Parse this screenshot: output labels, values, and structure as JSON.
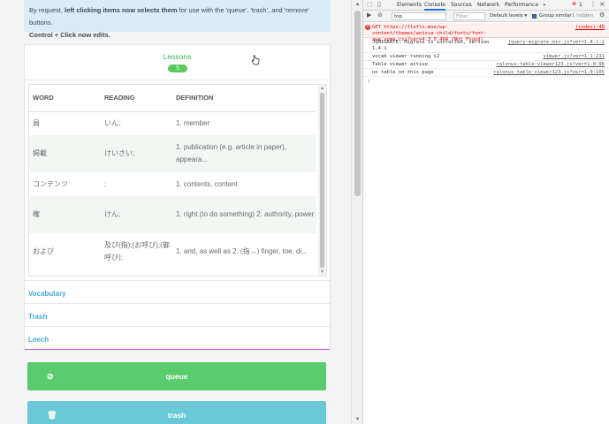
{
  "notice": {
    "line1_pre": "By request, ",
    "line1_bold": "left clicking items now selects them",
    "line1_post": " for use with the 'queue', 'trash', and 'remove' buttons.",
    "line2": "Control + Click now edits."
  },
  "lessons": {
    "title": "Lessons",
    "count": "5"
  },
  "table": {
    "headers": [
      "WORD",
      "READING",
      "DEFINITION"
    ],
    "rows": [
      {
        "word": "員",
        "reading": "いん;",
        "definition": "1. member"
      },
      {
        "word": "掲載",
        "reading": "けいさい;",
        "definition": "1. publication (e.g. article in paper), appeara..."
      },
      {
        "word": "コンテンツ",
        "reading": ";",
        "definition": "1. contents, content"
      },
      {
        "word": "権",
        "reading": "けん;",
        "definition": "1. right (to do something) 2. authority, power"
      },
      {
        "word": "および",
        "reading": "及び(指);(お呼び);(御呼び);",
        "definition": "1. and, as well as 2. (指→) finger, toe, di..."
      }
    ]
  },
  "accordion": {
    "vocabulary": "Vocabulary",
    "trash": "Trash",
    "leech": "Leech"
  },
  "buttons": {
    "queue": "queue",
    "trash": "trash"
  },
  "devtools": {
    "tabs": [
      "Elements",
      "Console",
      "Sources",
      "Network",
      "Performance",
      "»"
    ],
    "error_count": "1",
    "context": "top",
    "filter_placeholder": "Filter",
    "levels": "Default levels ▾",
    "group_similar": "Group similar",
    "hidden": "1 hidden",
    "logs": [
      {
        "type": "error",
        "msg": "GET https://floflo.moe/wp-content/themes/anissa-child/fonts/font-awe some.css?ver=4.3.0 404 (Not Found)",
        "src": "(index):48"
      },
      {
        "type": "log",
        "msg": "JQMIGRATE: Migrate is installed, version 1.4.1",
        "src": "jquery-migrate.min.js?ver=1.4.1:2"
      },
      {
        "type": "log",
        "msg": "vocab viewer running v2",
        "src": "viewer.js?ver=1.1:231"
      },
      {
        "type": "log",
        "msg": "Table viewer active.",
        "src": "ralonus-table-viewer123.js?ver=1.0:96"
      },
      {
        "type": "log",
        "msg": "no table on this page",
        "src": "ralonus-table-viewer123.js?ver=1.0:105"
      }
    ],
    "prompt": "›"
  }
}
